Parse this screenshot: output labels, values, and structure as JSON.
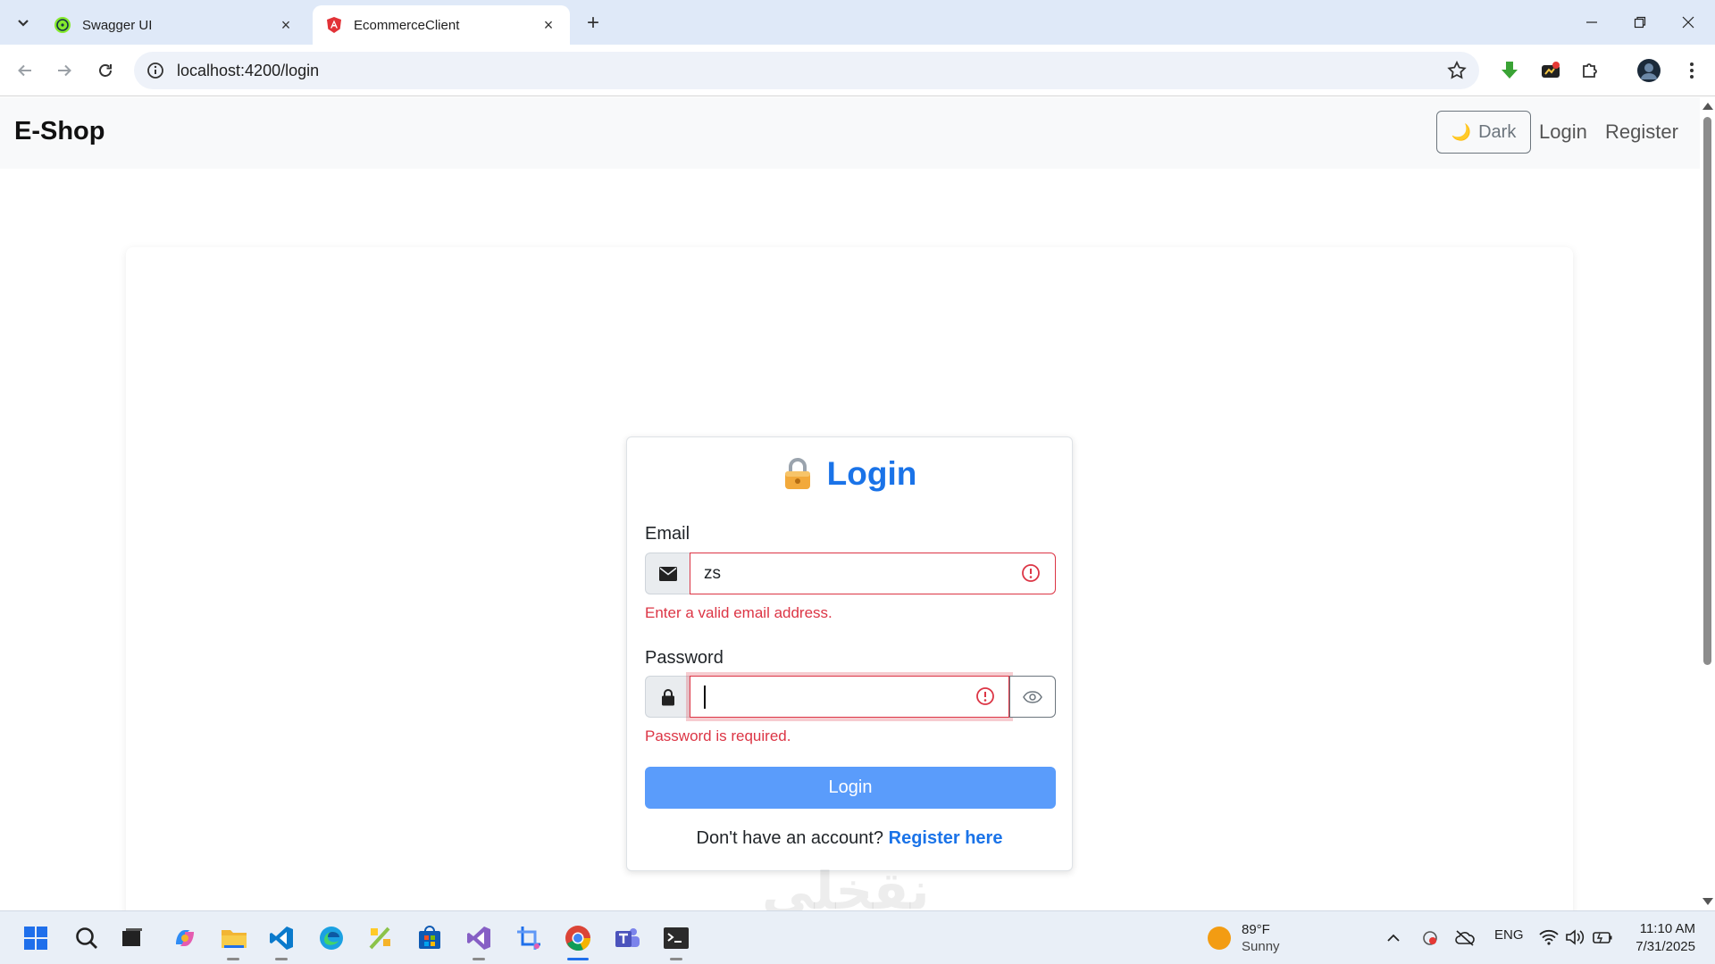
{
  "browser": {
    "tabs": [
      {
        "title": "Swagger UI",
        "active": false,
        "favicon": "swagger-icon"
      },
      {
        "title": "EcommerceClient",
        "active": true,
        "favicon": "angular-icon"
      }
    ],
    "url": "localhost:4200/login"
  },
  "navbar": {
    "brand": "E-Shop",
    "theme_label": "Dark",
    "theme_icon": "moon-icon",
    "login_label": "Login",
    "register_label": "Register"
  },
  "login_form": {
    "title": "Login",
    "title_icon": "locked-padlock-icon",
    "email_label": "Email",
    "email_value": "zs",
    "email_error": "Enter a valid email address.",
    "password_label": "Password",
    "password_value": "",
    "password_error": "Password is required.",
    "submit_label": "Login",
    "register_prompt": "Don't have an account?",
    "register_link": "Register here"
  },
  "watermark": "نقخلي",
  "taskbar": {
    "weather_temp": "89°F",
    "weather_desc": "Sunny",
    "language": "ENG",
    "time": "11:10 AM",
    "date": "7/31/2025"
  },
  "colors": {
    "accent": "#1a73e8",
    "error": "#dc3545",
    "button": "#5a9cfb"
  }
}
